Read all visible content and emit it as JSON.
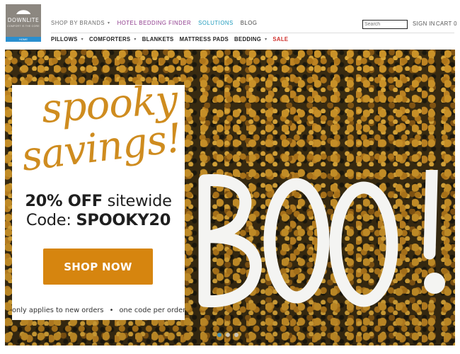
{
  "brand": {
    "name": "DOWNLITE",
    "tagline": "COMFORT IS THE CORE",
    "home_badge": "HOME"
  },
  "nav_top": [
    {
      "label": "SHOP BY BRANDS",
      "has_caret": true,
      "color": "#6b6b6b"
    },
    {
      "label": "HOTEL BEDDING FINDER",
      "has_caret": false,
      "color": "#8e3a8c"
    },
    {
      "label": "SOLUTIONS",
      "has_caret": false,
      "color": "#1f9bbd"
    },
    {
      "label": "BLOG",
      "has_caret": false,
      "color": "#444444"
    }
  ],
  "search": {
    "placeholder": "Search"
  },
  "account": {
    "sign_in": "SIGN IN",
    "cart": "CART 0"
  },
  "nav_bottom": [
    {
      "label": "PILLOWS",
      "has_caret": true
    },
    {
      "label": "COMFORTERS",
      "has_caret": true
    },
    {
      "label": "BLANKETS",
      "has_caret": false
    },
    {
      "label": "MATTRESS PADS",
      "has_caret": false
    },
    {
      "label": "BEDDING",
      "has_caret": true
    },
    {
      "label": "SALE",
      "has_caret": false
    }
  ],
  "colors": {
    "sale": "#d0312d",
    "accent_orange": "#d6850f",
    "script_gold": "#cf8c1f",
    "carousel_active": "#2a8fcf"
  },
  "promo": {
    "headline_line1": "spooky",
    "headline_line2": "savings!",
    "offer_bold": "20% OFF",
    "offer_rest": "sitewide",
    "code_label": "Code:",
    "code": "SPOOKY20",
    "cta": "SHOP NOW",
    "fine_print_1": "only applies to new orders",
    "fine_print_sep": "•",
    "fine_print_2": "one code per order"
  },
  "hero_art": {
    "text": "BOO!",
    "icon": "leaves-background"
  },
  "carousel": {
    "slides": 3,
    "active": 1
  }
}
